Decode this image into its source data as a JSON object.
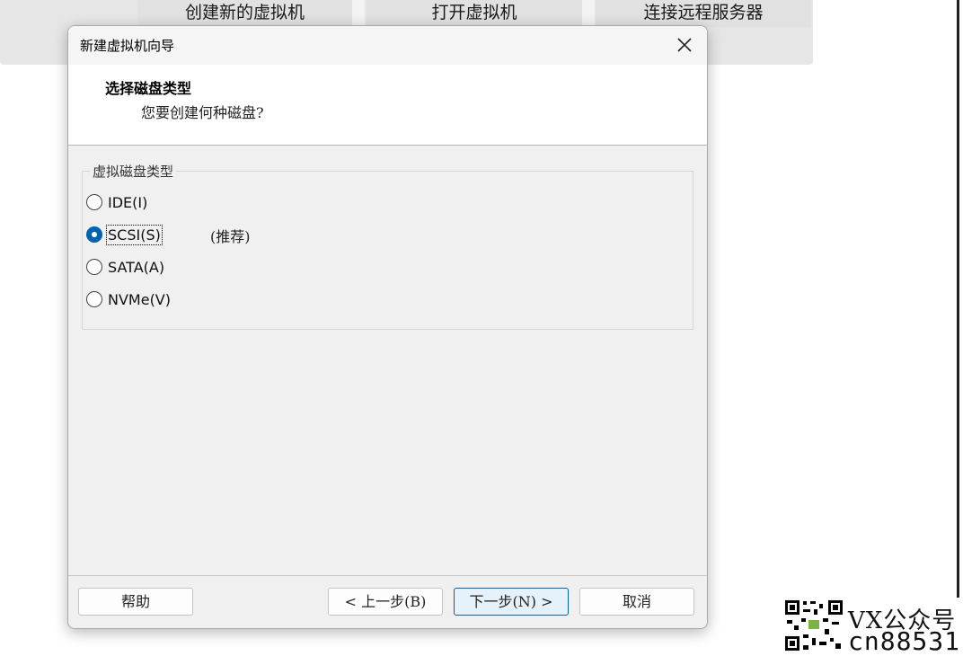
{
  "background": {
    "buttons": [
      "创建新的虚拟机",
      "打开虚拟机",
      "连接远程服务器"
    ]
  },
  "dialog": {
    "title": "新建虚拟机向导",
    "header_title": "选择磁盘类型",
    "header_subtitle": "您要创建何种磁盘?",
    "group_label": "虚拟磁盘类型",
    "options": [
      {
        "label": "IDE(I)",
        "selected": false
      },
      {
        "label": "SCSI(S)",
        "selected": true
      },
      {
        "label": "SATA(A)",
        "selected": false
      },
      {
        "label": "NVMe(V)",
        "selected": false
      }
    ],
    "recommend_note": "(推荐)",
    "buttons": {
      "help": "帮助",
      "back": "< 上一步(B)",
      "next": "下一步(N) >",
      "cancel": "取消"
    }
  },
  "watermark": {
    "line1": "VX公众号",
    "line2": "cn88531"
  },
  "colors": {
    "accent": "#0063b1",
    "dialog_bg": "#f0f0f0",
    "header_bg": "#ffffff"
  }
}
